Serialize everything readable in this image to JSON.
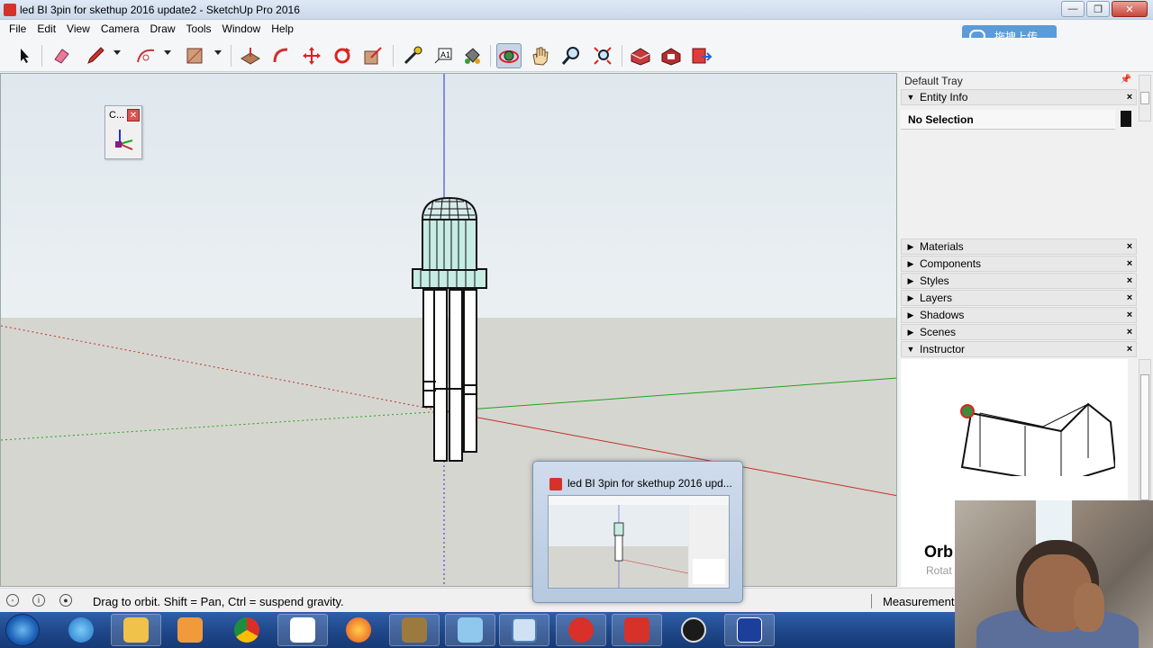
{
  "window": {
    "title": "led BI 3pin for skethup 2016 update2 - SketchUp Pro 2016",
    "minimize_glyph": "—",
    "maximize_glyph": "❐",
    "close_glyph": "✕"
  },
  "menu": [
    "File",
    "Edit",
    "View",
    "Camera",
    "Draw",
    "Tools",
    "Window",
    "Help"
  ],
  "upload_button": "拖拽上传",
  "toolbar": {
    "tools": [
      "select-icon",
      "eraser-icon",
      "pencil-icon",
      "arc-icon",
      "rectangle-icon",
      "push-pull-icon",
      "follow-me-icon",
      "move-icon",
      "rotate-icon",
      "scale-icon",
      "tape-measure-icon",
      "text-icon",
      "paint-bucket-icon",
      "orbit-icon",
      "pan-icon",
      "zoom-icon",
      "zoom-extents-icon",
      "warehouse-icon",
      "extension-warehouse-icon",
      "send-to-layout-icon"
    ],
    "active": "orbit-icon"
  },
  "axes_window": {
    "title": "C...",
    "close_glyph": "✕"
  },
  "tray": {
    "title": "Default Tray",
    "pin_glyph": "📌",
    "close_glyph": "✕",
    "entity_info": {
      "label": "Entity Info",
      "selection": "No Selection"
    },
    "panels": [
      "Materials",
      "Components",
      "Styles",
      "Layers",
      "Shadows",
      "Scenes",
      "Instructor"
    ],
    "instructor": {
      "heading": "Orb",
      "subheading": "Rotat"
    }
  },
  "status": {
    "message": "Drag to orbit. Shift = Pan, Ctrl = suspend gravity.",
    "measurements_label": "Measurement"
  },
  "thumbnail_popup": {
    "title": "led BI 3pin for skethup 2016 upd..."
  },
  "taskbar": {
    "apps": [
      "internet-explorer-icon",
      "file-explorer-icon",
      "media-player-icon",
      "chrome-icon",
      "baidu-cloud-icon",
      "firefox-icon",
      "archive-icon",
      "notepad-icon",
      "screenshot-icon",
      "presentation-icon",
      "sketchup-icon",
      "obs-icon",
      "isis-icon"
    ]
  },
  "colors": {
    "axis_red": "#c0302a",
    "axis_green": "#1fa31f",
    "axis_blue": "#2b2bd6",
    "tray_bg": "#f0f0f0",
    "taskbar": "#1e4587"
  }
}
